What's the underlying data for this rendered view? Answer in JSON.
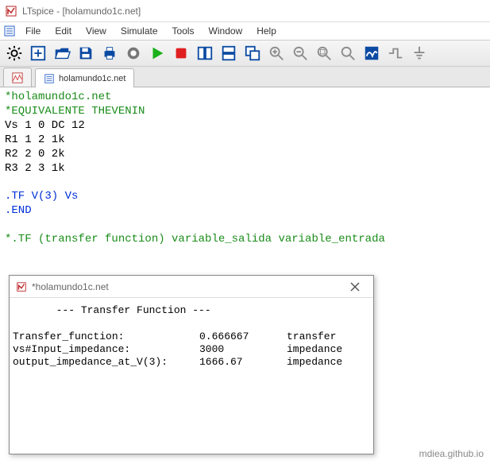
{
  "window": {
    "title": "LTspice - [holamundo1c.net]"
  },
  "menu": {
    "file": "File",
    "edit": "Edit",
    "view": "View",
    "simulate": "Simulate",
    "tools": "Tools",
    "window": "Window",
    "help": "Help"
  },
  "tabs": {
    "waveform_label": "",
    "netlist_label": "holamundo1c.net"
  },
  "netlist": {
    "line1": "*holamundo1c.net",
    "line2": "*EQUIVALENTE THEVENIN",
    "line3": "Vs 1 0 DC 12",
    "line4": "R1 1 2 1k",
    "line5": "R2 2 0 2k",
    "line6": "R3 2 3 1k",
    "line7": "",
    "line8": ".TF V(3) Vs",
    "line9": ".END",
    "line10": "",
    "line11": "*.TF (transfer function) variable_salida variable_entrada"
  },
  "output_window": {
    "title": "*holamundo1c.net",
    "header": "       --- Transfer Function ---",
    "rows": [
      {
        "label": "Transfer_function:",
        "value": "0.666667",
        "unit": "transfer"
      },
      {
        "label": "vs#Input_impedance:",
        "value": "3000",
        "unit": "impedance"
      },
      {
        "label": "output_impedance_at_V(3):",
        "value": "1666.67",
        "unit": "impedance"
      }
    ]
  },
  "watermark": "mdiea.github.io"
}
